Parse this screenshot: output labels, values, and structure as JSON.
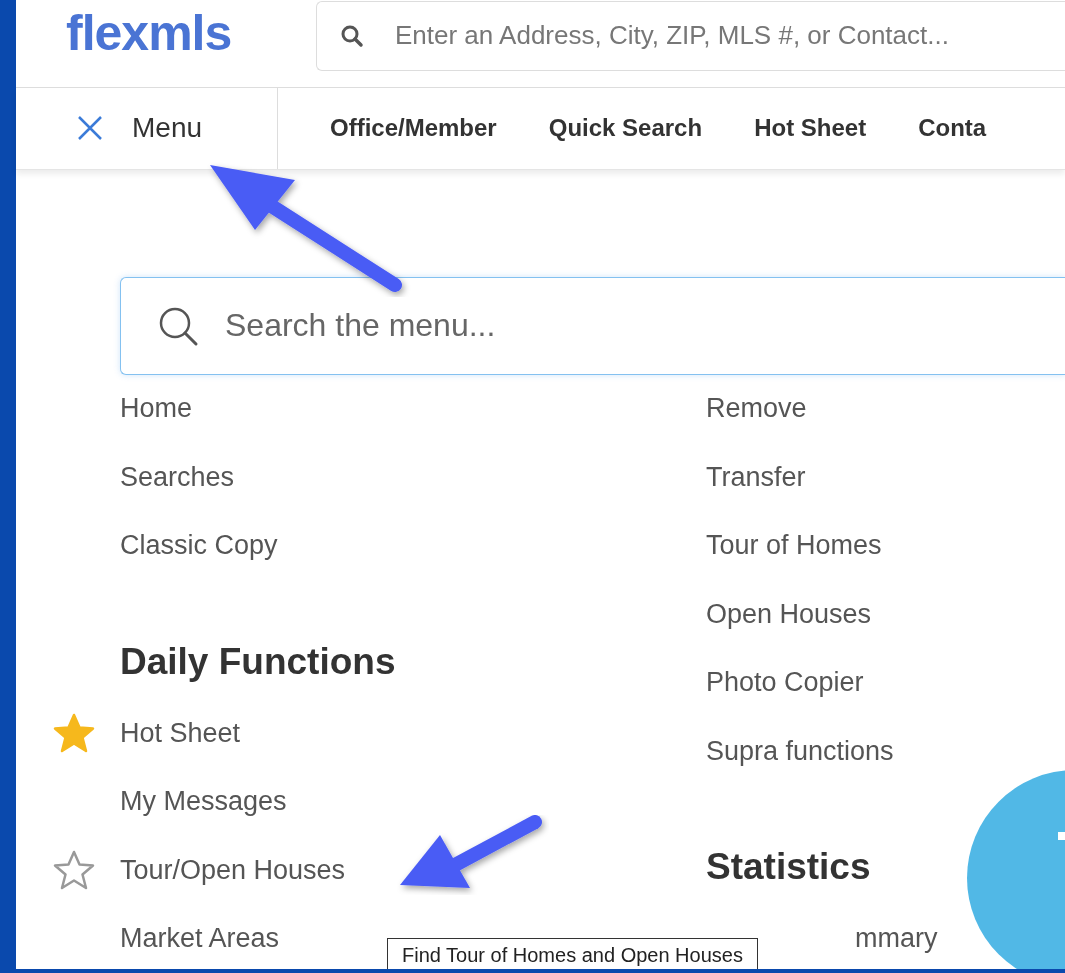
{
  "header": {
    "logo": "flexmls",
    "search": {
      "placeholder": "Enter an Address, City, ZIP, MLS #, or Contact..."
    }
  },
  "nav": {
    "menu_label": "Menu",
    "items": [
      "Office/Member",
      "Quick Search",
      "Hot Sheet",
      "Conta"
    ]
  },
  "menu_search": {
    "placeholder": "Search the menu..."
  },
  "columns": [
    [
      {
        "kind": "item",
        "label": "Home"
      },
      {
        "kind": "item",
        "label": "Searches"
      },
      {
        "kind": "item",
        "label": "Classic Copy"
      },
      {
        "kind": "heading",
        "label": "Daily Functions"
      },
      {
        "kind": "item",
        "label": "Hot Sheet",
        "favorite": true
      },
      {
        "kind": "item",
        "label": "My Messages"
      },
      {
        "kind": "item",
        "label": "Tour/Open Houses",
        "favorite": false
      },
      {
        "kind": "item",
        "label": "Market Areas"
      }
    ],
    [
      {
        "kind": "item",
        "label": "Remove"
      },
      {
        "kind": "item",
        "label": "Transfer"
      },
      {
        "kind": "item",
        "label": "Tour of Homes"
      },
      {
        "kind": "item",
        "label": "Open Houses"
      },
      {
        "kind": "item",
        "label": "Photo Copier"
      },
      {
        "kind": "item",
        "label": "Supra functions"
      },
      {
        "kind": "heading",
        "label": "Statistics"
      },
      {
        "kind": "covered",
        "label": "mmary"
      }
    ]
  ],
  "tooltip": "Find Tour of Homes and Open Houses"
}
